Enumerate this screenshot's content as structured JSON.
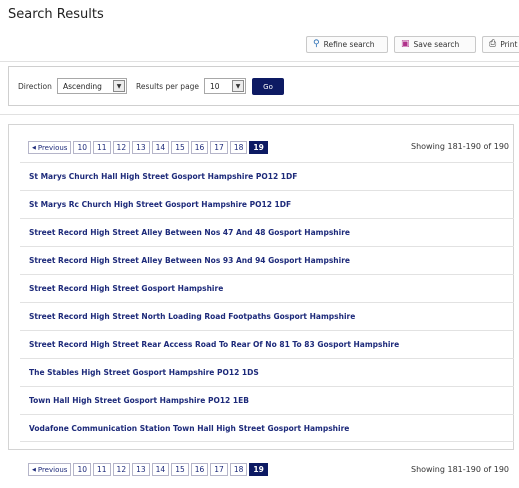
{
  "page": {
    "title": "Search Results"
  },
  "actions": {
    "refine_label": "Refine search",
    "save_label": "Save search",
    "print_label": "Print"
  },
  "options": {
    "direction_label": "Direction",
    "direction_value": "Ascending",
    "per_page_label": "Results per page",
    "per_page_value": "10",
    "go_label": "Go"
  },
  "pagination": {
    "previous_label": "Previous",
    "pages": [
      "10",
      "11",
      "12",
      "13",
      "14",
      "15",
      "16",
      "17",
      "18",
      "19"
    ],
    "current": "19",
    "showing": "Showing 181-190 of 190"
  },
  "results": [
    "St Marys Church Hall High Street Gosport Hampshire PO12 1DF",
    "St Marys Rc Church High Street Gosport Hampshire PO12 1DF",
    "Street Record High Street Alley Between Nos 47 And 48 Gosport Hampshire",
    "Street Record High Street Alley Between Nos 93 And 94 Gosport Hampshire",
    "Street Record High Street Gosport Hampshire",
    "Street Record High Street North Loading Road Footpaths Gosport Hampshire",
    "Street Record High Street Rear Access Road To Rear Of No 81 To 83 Gosport Hampshire",
    "The Stables High Street Gosport Hampshire PO12 1DS",
    "Town Hall High Street Gosport Hampshire PO12 1EB",
    "Vodafone Communication Station Town Hall High Street Gosport Hampshire"
  ],
  "colors": {
    "accent": "#0d1a63",
    "link": "#1d2a7a",
    "border": "#d4d4d4"
  },
  "icons": {
    "refine": "search-icon",
    "save": "save-icon",
    "print": "printer-icon",
    "previous": "chevron-left-icon",
    "dropdown": "chevron-down-icon"
  }
}
